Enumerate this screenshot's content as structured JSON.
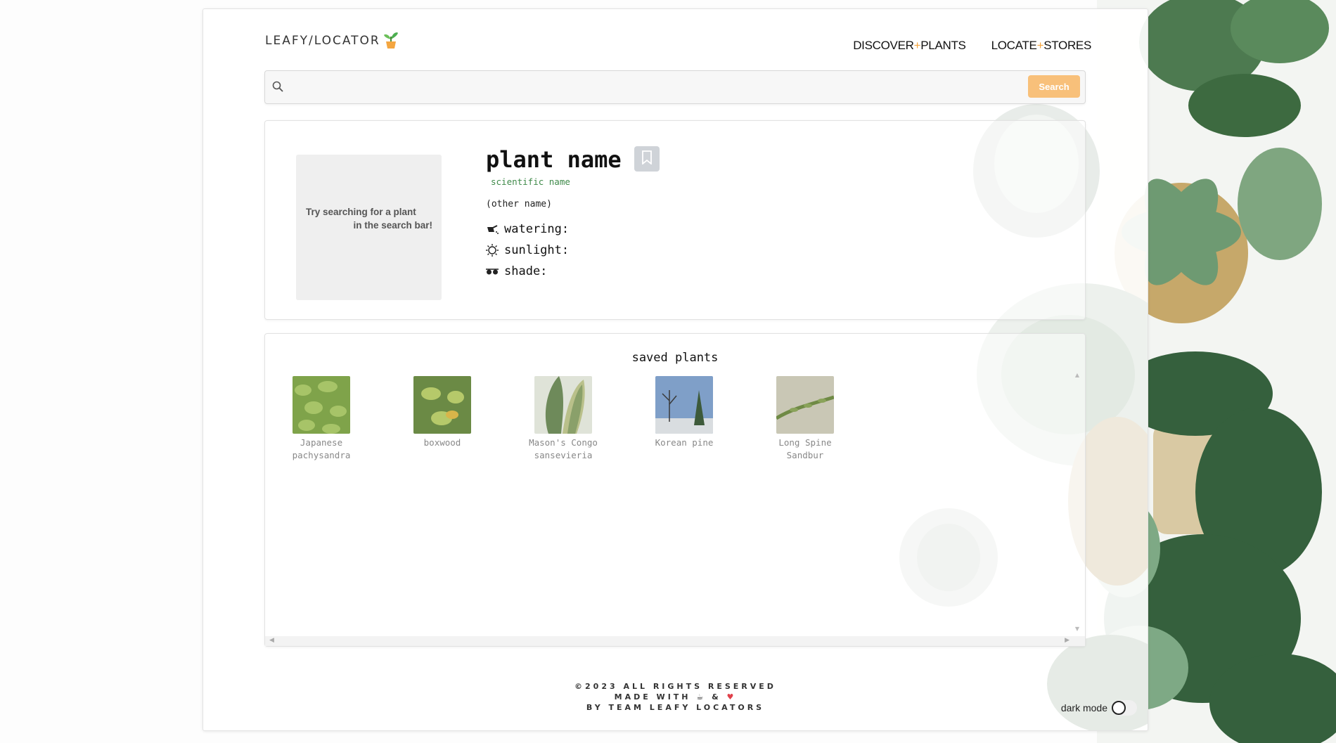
{
  "brand": {
    "name": "LEAFY/LOCATOR",
    "logo_icon": "potted-sprout-icon"
  },
  "nav": [
    {
      "prefix": "DISCOVER",
      "sep": "+",
      "suffix": "PLANTS"
    },
    {
      "prefix": "LOCATE",
      "sep": "+",
      "suffix": "STORES"
    }
  ],
  "search": {
    "value": "",
    "placeholder": "",
    "button_label": "Search",
    "icon": "search-icon"
  },
  "plant": {
    "placeholder_line1": "Try searching for a plant",
    "placeholder_line2": "in the search bar!",
    "name": "plant name",
    "scientific_name": "scientific name",
    "other_name": "(other name)",
    "attributes": [
      {
        "icon": "watering-can-icon",
        "label": "watering:"
      },
      {
        "icon": "sun-icon",
        "label": "sunlight:"
      },
      {
        "icon": "sunglasses-icon",
        "label": "shade:"
      }
    ],
    "bookmark_icon": "bookmark-icon"
  },
  "saved": {
    "title": "saved plants",
    "items": [
      {
        "line1": "Japanese",
        "line2": "pachysandra",
        "color": "#7fa34a"
      },
      {
        "line1": "boxwood",
        "line2": "",
        "color": "#8cab56"
      },
      {
        "line1": "Mason's Congo",
        "line2": "sansevieria",
        "color": "#7f9a6a"
      },
      {
        "line1": "Korean pine",
        "line2": "",
        "color": "#6c88b5"
      },
      {
        "line1": "Long Spine",
        "line2": "Sandbur",
        "color": "#a3b07c"
      }
    ]
  },
  "footer": {
    "line1": "©2023 ALL RIGHTS RESERVED",
    "line2_prefix": "MADE WITH",
    "line2_mid": "&",
    "line3": "BY TEAM LEAFY LOCATORS",
    "coffee_icon": "coffee-icon",
    "heart_icon": "heart-icon"
  },
  "dark_mode": {
    "label": "dark mode",
    "enabled": false
  },
  "colors": {
    "accent": "#f8c07a",
    "plus": "#f4a640",
    "scientific": "#3f8a4a"
  }
}
